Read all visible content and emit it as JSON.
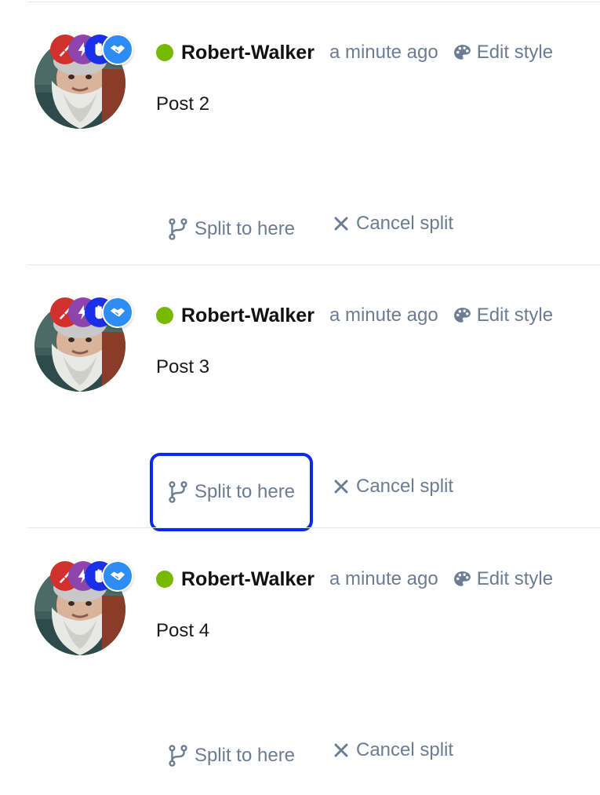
{
  "posts": [
    {
      "username": "Robert-Walker",
      "timestamp": "a minute ago",
      "edit_style_label": "Edit style",
      "body": "Post 2",
      "split_label": "Split to here",
      "cancel_label": "Cancel split",
      "split_focused": false
    },
    {
      "username": "Robert-Walker",
      "timestamp": "a minute ago",
      "edit_style_label": "Edit style",
      "body": "Post 3",
      "split_label": "Split to here",
      "cancel_label": "Cancel split",
      "split_focused": true
    },
    {
      "username": "Robert-Walker",
      "timestamp": "a minute ago",
      "edit_style_label": "Edit style",
      "body": "Post 4",
      "split_label": "Split to here",
      "cancel_label": "Cancel split",
      "split_focused": false
    }
  ],
  "icons": {
    "online_status": "online-dot-icon",
    "edit_style": "palette-icon",
    "split": "code-branch-icon",
    "cancel": "close-icon",
    "badges": [
      "paint-brush-badge-icon",
      "lightning-badge-icon",
      "hand-badge-icon",
      "handshake-badge-icon"
    ]
  },
  "colors": {
    "online": "#76b900",
    "muted_text": "#6b7c93",
    "focus_ring": "#0a2ae6",
    "badge_red": "#d0312d",
    "badge_purple": "#8e44ad",
    "badge_blue": "#1a2fe8",
    "badge_lightblue": "#2f8cf5"
  }
}
